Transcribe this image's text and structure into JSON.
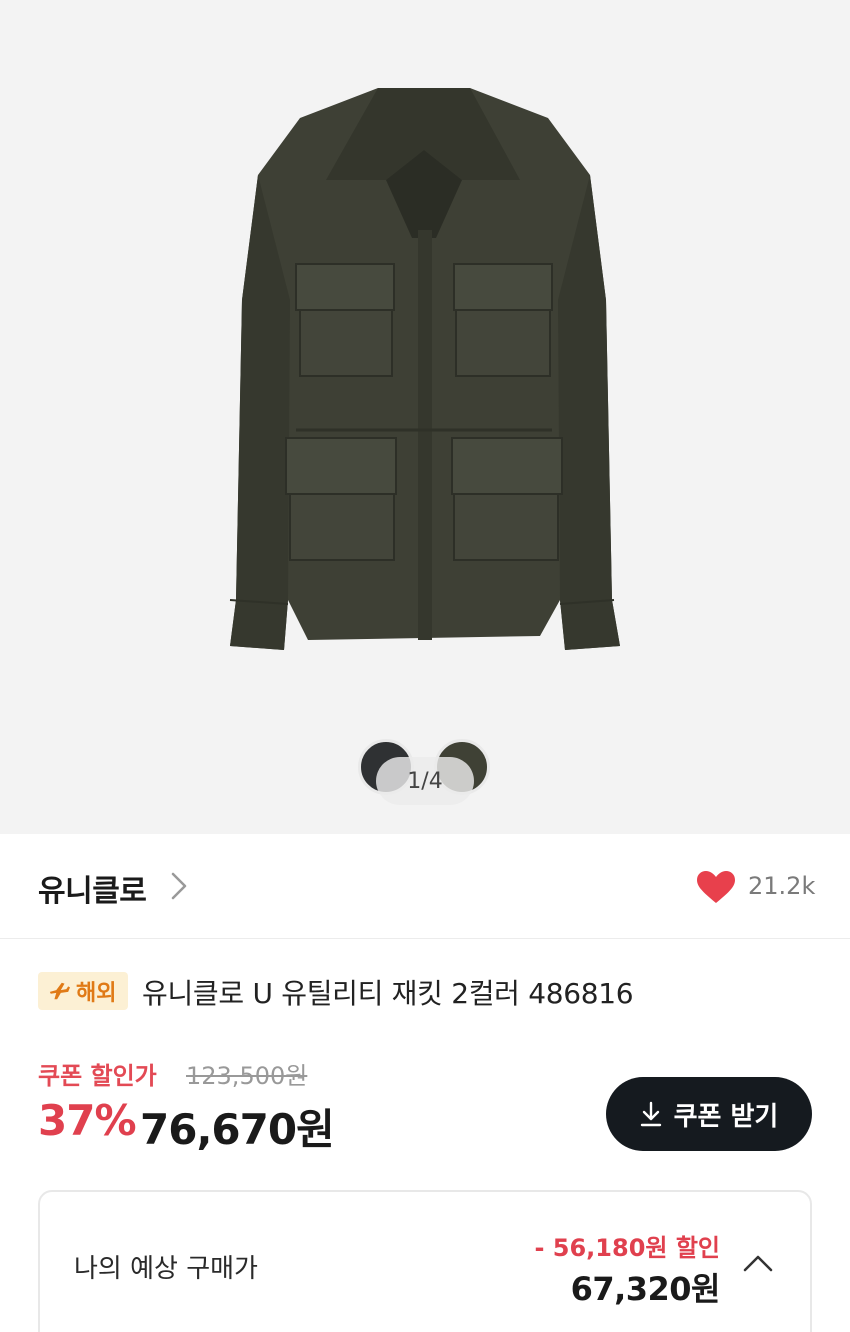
{
  "gallery": {
    "pager": "1/4",
    "swatches": [
      {
        "name": "charcoal",
        "color": "#2f3133"
      },
      {
        "name": "olive",
        "color": "#3f4135"
      }
    ],
    "product_color": "#3f4135"
  },
  "brand": {
    "name": "유니클로",
    "likes": "21.2k",
    "heart_color": "#e8404c"
  },
  "product": {
    "badge": "해외",
    "badge_icon": "airplane-icon",
    "title": "유니클로 U 유틸리티 재킷 2컬러 486816"
  },
  "pricing": {
    "coupon_label": "쿠폰 할인가",
    "original_price": "123,500원",
    "discount_rate": "37%",
    "price": "76,670원",
    "coupon_button": "쿠폰 받기",
    "accent_color": "#e0404e"
  },
  "estimate": {
    "label": "나의 예상 구매가",
    "discount": "- 56,180원 할인",
    "total": "67,320원"
  }
}
